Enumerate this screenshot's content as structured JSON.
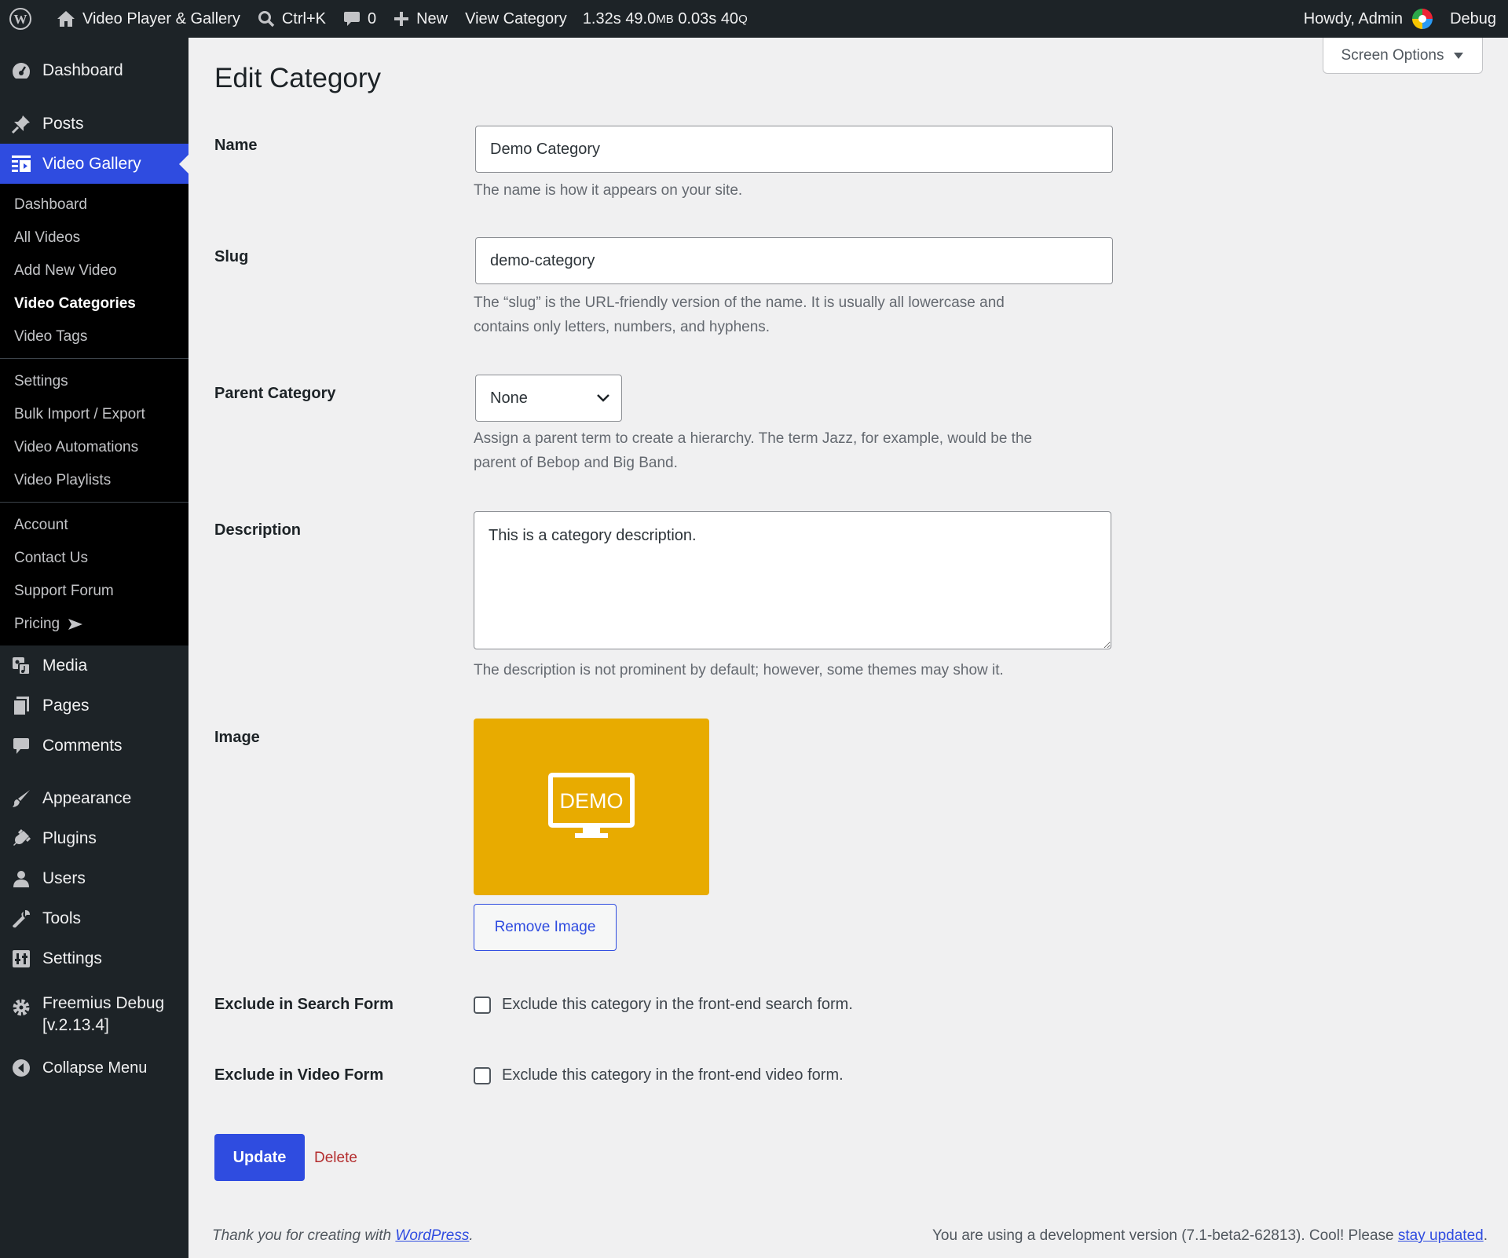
{
  "adminbar": {
    "site_name": "Video Player & Gallery",
    "search_shortcut": "Ctrl+K",
    "comments_count": "0",
    "new_label": "New",
    "view_label": "View Category",
    "perf_time": "1.32s",
    "perf_mem": "49.0",
    "perf_mem_unit": "MB",
    "perf_query_time": "0.03s",
    "perf_queries": "40",
    "perf_queries_unit": "Q",
    "howdy": "Howdy, Admin",
    "debug": "Debug"
  },
  "sidebar": {
    "dashboard": "Dashboard",
    "posts": "Posts",
    "video_gallery": "Video Gallery",
    "video_gallery_sub": [
      "Dashboard",
      "All Videos",
      "Add New Video",
      "Video Categories",
      "Video Tags"
    ],
    "video_gallery_sub2": [
      "Settings",
      "Bulk Import / Export",
      "Video Automations",
      "Video Playlists"
    ],
    "video_gallery_sub3": [
      "Account",
      "Contact Us",
      "Support Forum",
      "Pricing"
    ],
    "media": "Media",
    "pages": "Pages",
    "comments": "Comments",
    "appearance": "Appearance",
    "plugins": "Plugins",
    "users": "Users",
    "tools": "Tools",
    "settings": "Settings",
    "freemius_line1": "Freemius Debug",
    "freemius_line2": "[v.2.13.4]",
    "collapse": "Collapse Menu"
  },
  "screen_options": "Screen Options",
  "page_title": "Edit Category",
  "form": {
    "name_label": "Name",
    "name_value": "Demo Category",
    "name_desc": "The name is how it appears on your site.",
    "slug_label": "Slug",
    "slug_value": "demo-category",
    "slug_desc_1": "The “slug” is the URL-friendly version of the name. It is usually all lowercase and",
    "slug_desc_2": "contains only letters, numbers, and hyphens.",
    "parent_label": "Parent Category",
    "parent_value": "None",
    "parent_desc_1": "Assign a parent term to create a hierarchy. The term Jazz, for example, would be the",
    "parent_desc_2": "parent of Bebop and Big Band.",
    "description_label": "Description",
    "description_value": "This is a category description.",
    "description_desc": "The description is not prominent by default; however, some themes may show it.",
    "image_label": "Image",
    "image_text": "DEMO",
    "remove_image": "Remove Image",
    "exclude_search_label": "Exclude in Search Form",
    "exclude_search_text": "Exclude this category in the front-end search form.",
    "exclude_video_label": "Exclude in Video Form",
    "exclude_video_text": "Exclude this category in the front-end video form.",
    "update": "Update",
    "delete": "Delete"
  },
  "footer": {
    "left_text": "Thank you for creating with ",
    "left_link": "WordPress",
    "left_end": ".",
    "right_text": "You are using a development version (7.1-beta2-62813). Cool! Please ",
    "right_link": "stay updated",
    "right_end": "."
  },
  "colors": {
    "accent": "#2f4ce0",
    "sidebar_bg": "#1d2327",
    "image_bg": "#e8ab00",
    "delete": "#b32d2e"
  }
}
